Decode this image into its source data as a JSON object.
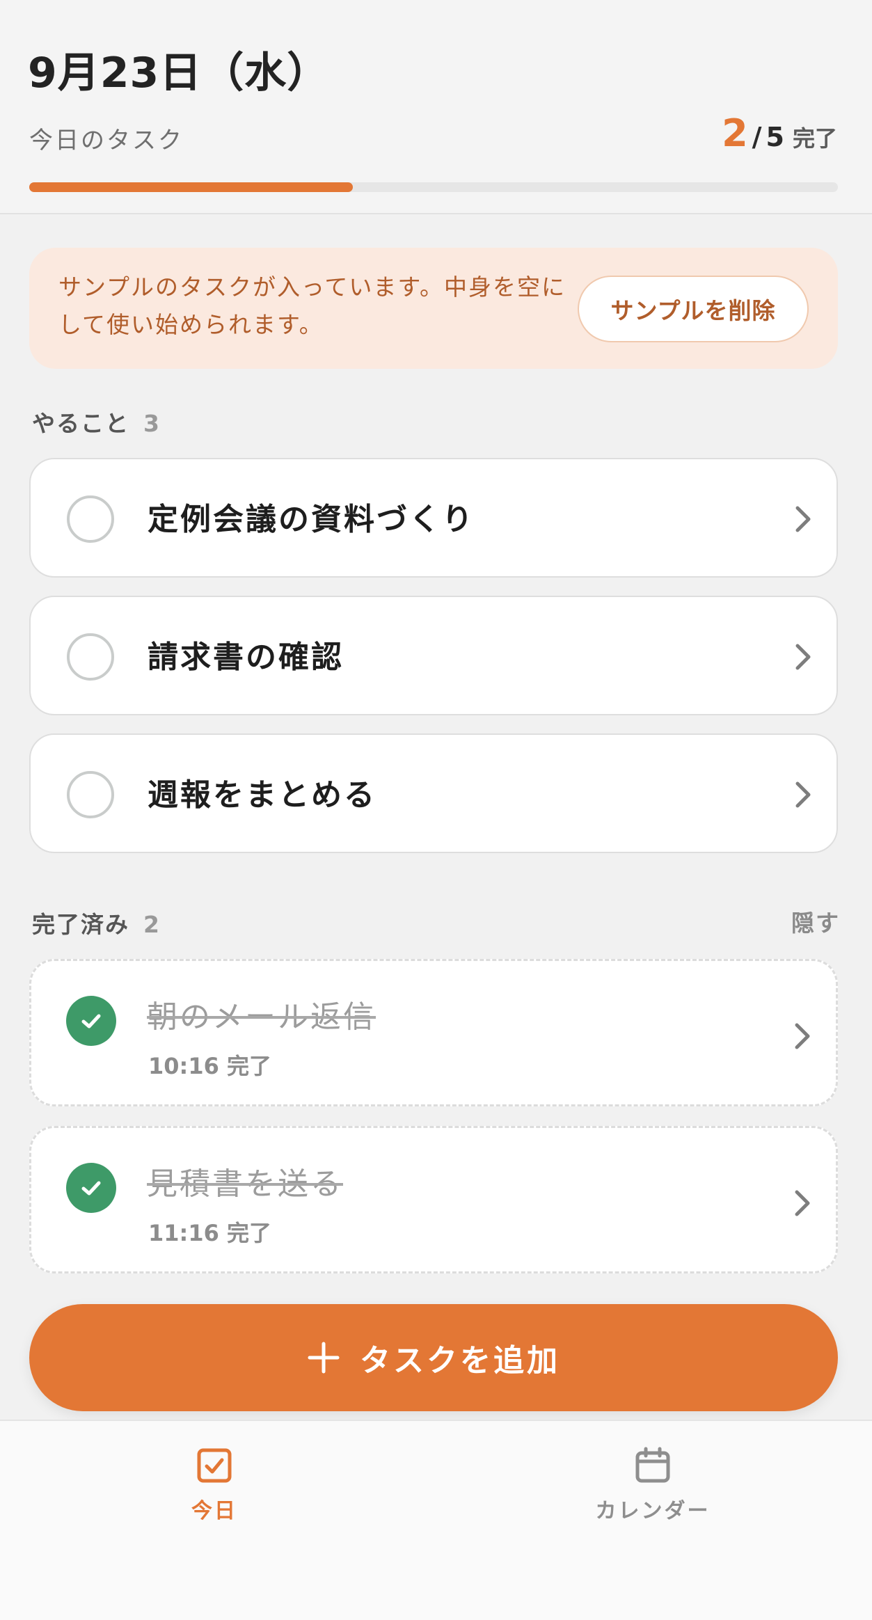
{
  "header": {
    "date": "9月23日（水）",
    "subtitle": "今日のタスク",
    "done_count": "2",
    "separator": "/",
    "total_count": "5",
    "done_label": "完了",
    "progress": 0.4
  },
  "notice": {
    "text": "サンプルのタスクが入っています。中身を空にして使い始められます。",
    "button_label": "サンプルを削除"
  },
  "todo_section": {
    "label": "やること",
    "count": "3",
    "tasks": [
      {
        "title": "定例会議の資料づくり"
      },
      {
        "title": "請求書の確認"
      },
      {
        "title": "週報をまとめる"
      }
    ]
  },
  "done_section": {
    "label": "完了済み",
    "count": "2",
    "hide_label": "隠す",
    "tasks": [
      {
        "title": "朝のメール返信",
        "time": "10:16 完了"
      },
      {
        "title": "見積書を送る",
        "time": "11:16 完了"
      }
    ]
  },
  "add_button": {
    "label": "タスクを追加",
    "icon": "plus-icon"
  },
  "bottom_nav": {
    "items": [
      {
        "label": "今日",
        "icon": "checkbox-icon",
        "active": true
      },
      {
        "label": "カレンダー",
        "icon": "calendar-icon",
        "active": false
      }
    ]
  },
  "colors": {
    "accent": "#e37735",
    "done_green": "#3e9a68",
    "notice_bg": "#fbe9df",
    "notice_text": "#b05d2b"
  }
}
